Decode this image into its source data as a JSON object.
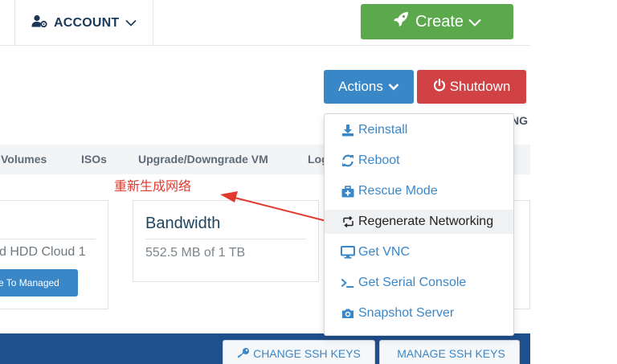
{
  "header": {
    "account_label": "ACCOUNT",
    "create_label": "Create"
  },
  "actions": {
    "actions_label": "Actions",
    "shutdown_label": "Shutdown",
    "partial_heading": "NG"
  },
  "tabs": [
    "Volumes",
    "ISOs",
    "Upgrade/Downgrade VM",
    "Log"
  ],
  "annotation": {
    "text": "重新生成网络",
    "color": "#e03a2f"
  },
  "cards": {
    "plan_text": "d HDD Cloud 1",
    "managed_button": "e To Managed",
    "bandwidth_title": "Bandwidth",
    "bandwidth_value": "552.5 MB of 1 TB"
  },
  "dropdown": {
    "items": [
      {
        "label": "Reinstall",
        "icon": "download-icon"
      },
      {
        "label": "Reboot",
        "icon": "refresh-icon"
      },
      {
        "label": "Rescue Mode",
        "icon": "medkit-icon"
      },
      {
        "label": "Regenerate Networking",
        "icon": "retweet-icon",
        "active": true
      },
      {
        "label": "Get VNC",
        "icon": "monitor-icon"
      },
      {
        "label": "Get Serial Console",
        "icon": "terminal-icon"
      },
      {
        "label": "Snapshot Server",
        "icon": "camera-icon"
      }
    ]
  },
  "footer": {
    "change_keys": "CHANGE SSH KEYS",
    "manage_keys": "MANAGE SSH KEYS"
  },
  "colors": {
    "primary_blue": "#3a87c8",
    "create_green": "#5ba84d",
    "shutdown_red": "#d04244",
    "navy": "#1f4f8c"
  }
}
